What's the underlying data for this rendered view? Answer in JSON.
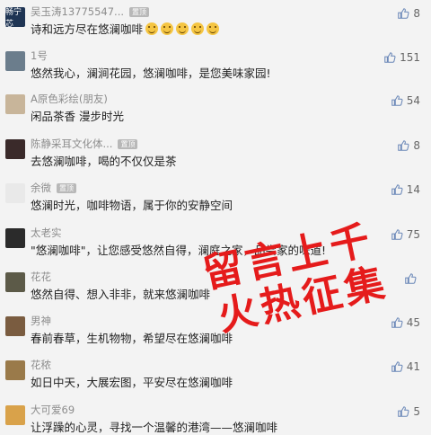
{
  "comments": [
    {
      "nick": "吴玉涛13775547...",
      "badge": "置顶",
      "text": "诗和远方尽在悠澜咖啡",
      "emojis": 5,
      "likes": "8",
      "avatar_bg": "#1f3554",
      "avatar_label": "畅宁芯"
    },
    {
      "nick": "1号",
      "badge": "",
      "text": "悠然我心，澜涧花园，悠澜咖啡，是您美味家园!",
      "emojis": 0,
      "likes": "151",
      "avatar_bg": "#6b7d8c",
      "avatar_label": ""
    },
    {
      "nick": "A原色彩绘(朋友)",
      "badge": "",
      "text": "闲品茶香 漫步时光",
      "emojis": 0,
      "likes": "54",
      "avatar_bg": "#c8b59a",
      "avatar_label": ""
    },
    {
      "nick": "陈静采耳文化体...",
      "badge": "置顶",
      "text": "去悠澜咖啡，喝的不仅仅是茶",
      "emojis": 0,
      "likes": "8",
      "avatar_bg": "#3a2a2a",
      "avatar_label": ""
    },
    {
      "nick": "余微",
      "badge": "置顶",
      "text": "悠澜时光，咖啡物语，属于你的安静空间",
      "emojis": 0,
      "likes": "14",
      "avatar_bg": "#e9e9e9",
      "avatar_label": ""
    },
    {
      "nick": "太老实",
      "badge": "",
      "text": "\"悠澜咖啡\"，让您感受悠然自得，澜庭之家，品尝家的味道!",
      "emojis": 0,
      "likes": "75",
      "avatar_bg": "#2b2b2b",
      "avatar_label": ""
    },
    {
      "nick": "花花",
      "badge": "",
      "text": "悠然自得、想入非非，就来悠澜咖啡",
      "emojis": 0,
      "likes": "",
      "avatar_bg": "#5c5a48",
      "avatar_label": ""
    },
    {
      "nick": "男神",
      "badge": "",
      "text": "春前春草，生机物物，希望尽在悠澜咖啡",
      "emojis": 0,
      "likes": "45",
      "avatar_bg": "#7a5c40",
      "avatar_label": ""
    },
    {
      "nick": "花秾",
      "badge": "",
      "text": "如日中天，大展宏图，平安尽在悠澜咖啡",
      "emojis": 0,
      "likes": "41",
      "avatar_bg": "#9a7a4a",
      "avatar_label": ""
    },
    {
      "nick": "大可爱69",
      "badge": "",
      "text": "让浮躁的心灵，寻找一个温馨的港湾——悠澜咖啡",
      "emojis": 0,
      "likes": "5",
      "avatar_bg": "#d9a24a",
      "avatar_label": ""
    }
  ],
  "overlay": {
    "line1": "留言上千",
    "line2": "火热征集"
  },
  "colors": {
    "overlay": "#e51b1b",
    "like_icon": "#6b88b8"
  }
}
